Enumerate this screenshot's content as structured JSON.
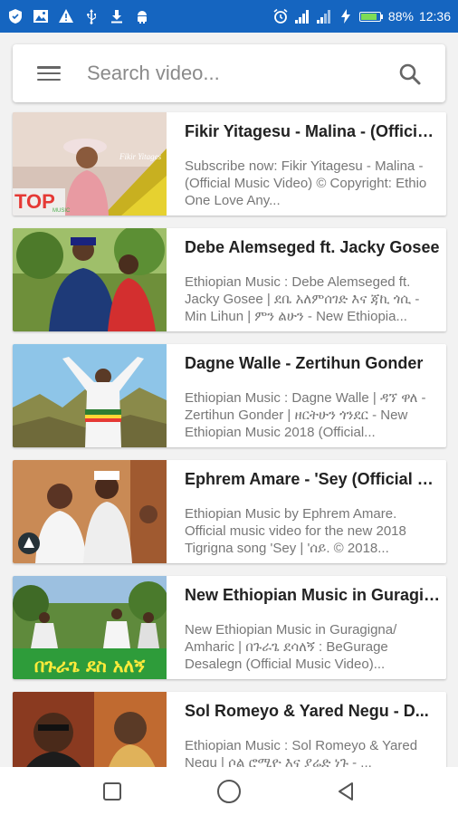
{
  "status_bar": {
    "battery_percent": "88%",
    "battery_level": 0.88,
    "time": "12:36",
    "icons": [
      "shield-icon",
      "image-icon",
      "warning-icon",
      "usb-icon",
      "download-icon",
      "android-icon",
      "alarm-icon",
      "signal-icon",
      "signal-icon",
      "charging-icon",
      "battery-icon"
    ],
    "bg_color": "#1565c0"
  },
  "search": {
    "placeholder": "Search video...",
    "value": ""
  },
  "videos": [
    {
      "title": "Fikir Yitagesu - Malina - (Official Music Video)",
      "description": "Subscribe now: Fikir Yitagesu - Malina - (Official Music Video) © Copyright: Ethio One Love Any...",
      "thumb_text": "Fikir Yitages",
      "thumb_badge": "TOP",
      "thumb_badge_sub": "MUSIC"
    },
    {
      "title": "Debe Alemseged ft. Jacky Gosee",
      "description": "Ethiopian Music : Debe Alemseged ft. Jacky Gosee | ደቤ አለምሰገድ እና ጃኪ ጎሲ - Min Lihun | ምን ልሁን - New Ethiopia..."
    },
    {
      "title": "Dagne Walle - Zertihun Gonder",
      "description": "Ethiopian Music : Dagne Walle | ዳኘ ዋለ - Zertihun Gonder | ዘርትሁን ጎንደር - New Ethiopian Music 2018 (Official..."
    },
    {
      "title": "Ephrem Amare - 'Sey (Official Music Video)",
      "description": "Ethiopian Music by Ephrem Amare. Official music video for the new 2018 Tigrigna song 'Sey | 'ሰይ. © 2018..."
    },
    {
      "title": "New Ethiopian Music in Guragigna",
      "description": "New Ethiopian Music in Guragigna/ Amharic | በጉራጌ ደሳለኝ : BeGurage Desalegn (Official Music Video)...",
      "thumb_text": "በጉራጌ ደስ አለኝ"
    },
    {
      "title": "Sol Romeyo & Yared Negu - D...",
      "description": "Ethiopian Music : Sol Romeyo & Yared Negu | ሶል ሮሚዮ እና ያሬድ ነጉ - ..."
    }
  ],
  "nav": {
    "items": [
      "recents-icon",
      "home-icon",
      "back-icon"
    ]
  }
}
